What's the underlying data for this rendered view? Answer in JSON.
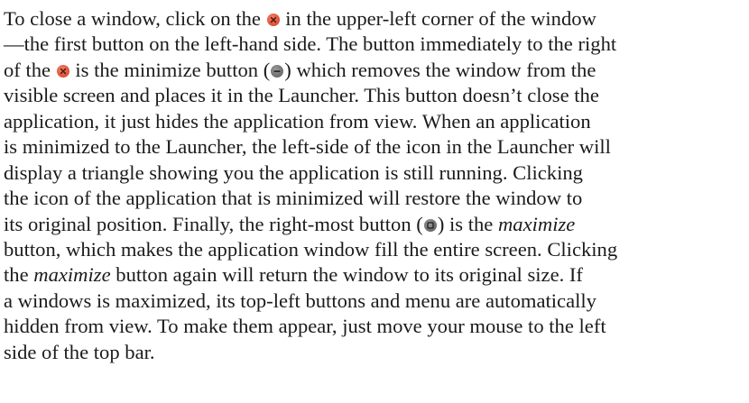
{
  "paragraph": {
    "l1": [
      "To close a window, click on the",
      "in the upper-left corner of the window"
    ],
    "l2": "—the first button on the left-hand side. The button immediately to the right",
    "l3": [
      "of the",
      "is the minimize button (",
      ") which removes the window from the"
    ],
    "l4": "visible screen and places it in the Launcher. This button doesn’t close the",
    "l5": "application, it just hides the application from view. When an application",
    "l6": "is minimized to the Launcher, the left-side of the icon in the Launcher will",
    "l7": "display a triangle showing you the application is still running. Clicking",
    "l8": "the icon of the application that is minimized will restore the window to",
    "l9": [
      "its original position. Finally, the right-most button (",
      ") is the",
      "maximize"
    ],
    "l10": "button, which makes the application window fill the entire screen. Clicking",
    "l11": [
      "the",
      "maximize",
      "button again will return the window to its original size. If"
    ],
    "l12": "a windows is maximized, its top-left buttons and menu are automatically",
    "l13": "hidden from view. To make them appear, just move your mouse to the left",
    "l14": "side of the top bar."
  },
  "icons": {
    "close": "close-icon",
    "minimize": "minimize-icon",
    "maximize": "maximize-icon",
    "close_color": "#e0553a",
    "window_button_gray": "#6e6e6e"
  }
}
